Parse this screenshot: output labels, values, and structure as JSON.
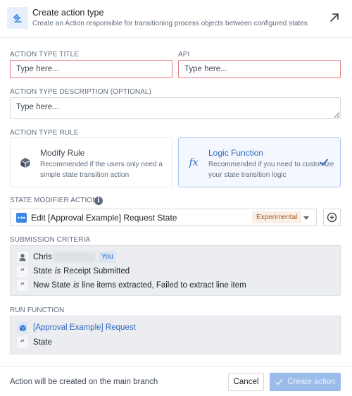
{
  "header": {
    "title": "Create action type",
    "subtitle": "Create an Action responsible for transitioning process objects between configured states",
    "icon": "gavel-icon",
    "external_icon": "arrow-up-right-icon"
  },
  "form": {
    "title_label": "ACTION TYPE TITLE",
    "title_placeholder": "Type here...",
    "title_value": "",
    "api_label": "API",
    "api_placeholder": "Type here...",
    "api_value": "",
    "description_label": "ACTION TYPE DESCRIPTION (OPTIONAL)",
    "description_placeholder": "Type here...",
    "description_value": ""
  },
  "rule": {
    "label": "ACTION TYPE RULE",
    "options": [
      {
        "title": "Modify Rule",
        "description": "Recommended if the users only need a simple state transition action",
        "icon": "cube-icon",
        "selected": false
      },
      {
        "title": "Logic Function",
        "description": "Recommended if you need to customize your state transition logic",
        "icon": "function-icon",
        "selected": true
      }
    ]
  },
  "state_modifier": {
    "label": "STATE MODIFIER ACTION",
    "selected": "Edit [Approval Example] Request State",
    "badge": "Experimental",
    "info_glyph": "i"
  },
  "submission_criteria": {
    "label": "SUBMISSION CRITERIA",
    "user": {
      "name": "Chris",
      "tag": "You"
    },
    "conditions": [
      {
        "field": "State",
        "operator": "is",
        "value": "Receipt Submitted"
      },
      {
        "field": "New State",
        "operator": "is",
        "value": "line items extracted, Failed to extract line item"
      }
    ]
  },
  "run_function": {
    "label": "RUN FUNCTION",
    "object": "[Approval Example] Request",
    "property": "State"
  },
  "footer": {
    "note": "Action will be created on the main branch",
    "cancel_label": "Cancel",
    "create_label": "Create action"
  },
  "colors": {
    "accent": "#2d66c1",
    "error_border": "#e07a80",
    "primary_disabled": "#9bbbea",
    "badge_bg": "#f8efe6",
    "badge_text": "#a85c1c"
  }
}
